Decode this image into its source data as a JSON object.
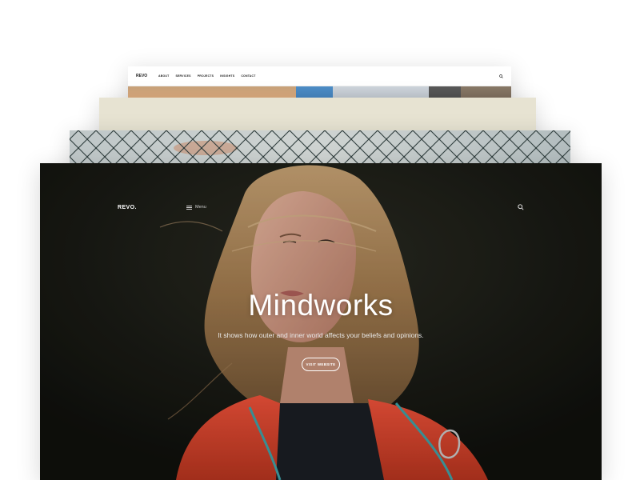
{
  "stack": {
    "card1": {
      "logo": "REVO",
      "nav_items": [
        "ABOUT",
        "SERVICES",
        "PROJECTS",
        "INSIGHTS",
        "CONTACT"
      ],
      "icon": "search-icon"
    },
    "card4": {
      "brand": "REVO.",
      "menu_label": "Menu",
      "title": "Mindworks",
      "subtitle": "It shows how outer and inner world affects your beliefs and opinions.",
      "cta_label": "VISIT WEBSITE",
      "icons": [
        "menu-icon",
        "search-icon"
      ]
    }
  },
  "colors": {
    "hero_bg": "#14140f",
    "text": "#ffffff",
    "jacket": "#e2462a"
  }
}
